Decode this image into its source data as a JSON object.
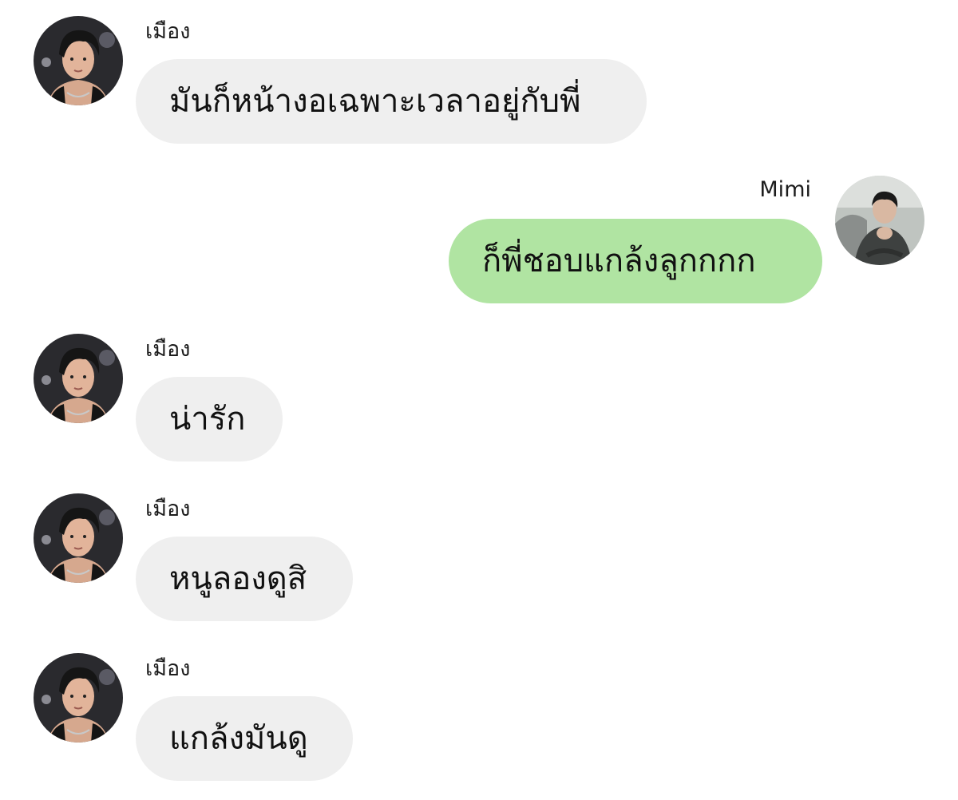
{
  "colors": {
    "incoming_bubble": "#efefef",
    "outgoing_bubble": "#b0e4a2",
    "background": "#ffffff",
    "text": "#111111"
  },
  "messages": [
    {
      "sender": "เมือง",
      "direction": "incoming",
      "text": "มันก็หน้างอเฉพาะเวลาอยู่กับพี่",
      "avatar": "muang-avatar"
    },
    {
      "sender": "Mimi",
      "direction": "outgoing",
      "text": "ก็พี่ชอบแกล้งลูกกกก",
      "avatar": "mimi-avatar"
    },
    {
      "sender": "เมือง",
      "direction": "incoming",
      "text": "น่ารัก",
      "avatar": "muang-avatar"
    },
    {
      "sender": "เมือง",
      "direction": "incoming",
      "text": "หนูลองดูสิ",
      "avatar": "muang-avatar"
    },
    {
      "sender": "เมือง",
      "direction": "incoming",
      "text": "แกล้งมันดู",
      "avatar": "muang-avatar"
    }
  ]
}
